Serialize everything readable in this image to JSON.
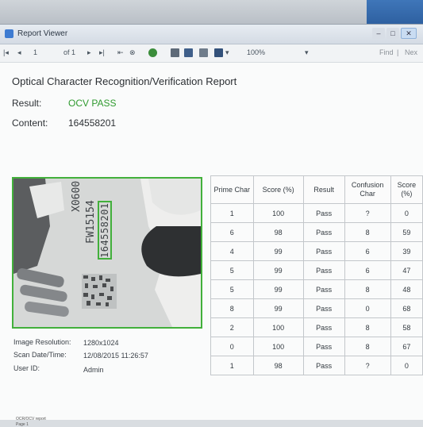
{
  "window": {
    "title": "Report Viewer"
  },
  "toolbar": {
    "page_current": "1",
    "page_of": "of 1",
    "zoom": "100%",
    "find": "Find",
    "next": "Nex"
  },
  "report": {
    "title": "Optical Character Recognition/Verification Report",
    "result_label": "Result:",
    "result_value": "OCV PASS",
    "content_label": "Content:",
    "content_value": "164558201",
    "image_text_1": "X0600",
    "image_text_2": "FW15154",
    "image_text_3": "164558201",
    "meta": {
      "resolution_label": "Image Resolution:",
      "resolution_value": "1280x1024",
      "scan_label": "Scan Date/Time:",
      "scan_value": "12/08/2015 11:26:57",
      "user_label": "User ID:",
      "user_value": "Admin"
    },
    "footer_line1": "OCR/OCV report",
    "footer_line2": "Page 1",
    "table": {
      "headers": [
        "Prime Char",
        "Score (%)",
        "Result",
        "Confusion Char",
        "Score (%)"
      ],
      "rows": [
        [
          "1",
          "100",
          "Pass",
          "?",
          "0"
        ],
        [
          "6",
          "98",
          "Pass",
          "8",
          "59"
        ],
        [
          "4",
          "99",
          "Pass",
          "6",
          "39"
        ],
        [
          "5",
          "99",
          "Pass",
          "6",
          "47"
        ],
        [
          "5",
          "99",
          "Pass",
          "8",
          "48"
        ],
        [
          "8",
          "99",
          "Pass",
          "0",
          "68"
        ],
        [
          "2",
          "100",
          "Pass",
          "8",
          "58"
        ],
        [
          "0",
          "100",
          "Pass",
          "8",
          "67"
        ],
        [
          "1",
          "98",
          "Pass",
          "?",
          "0"
        ]
      ]
    }
  },
  "colors": {
    "pass_green": "#2f9a2f",
    "image_border": "#42b03b"
  }
}
